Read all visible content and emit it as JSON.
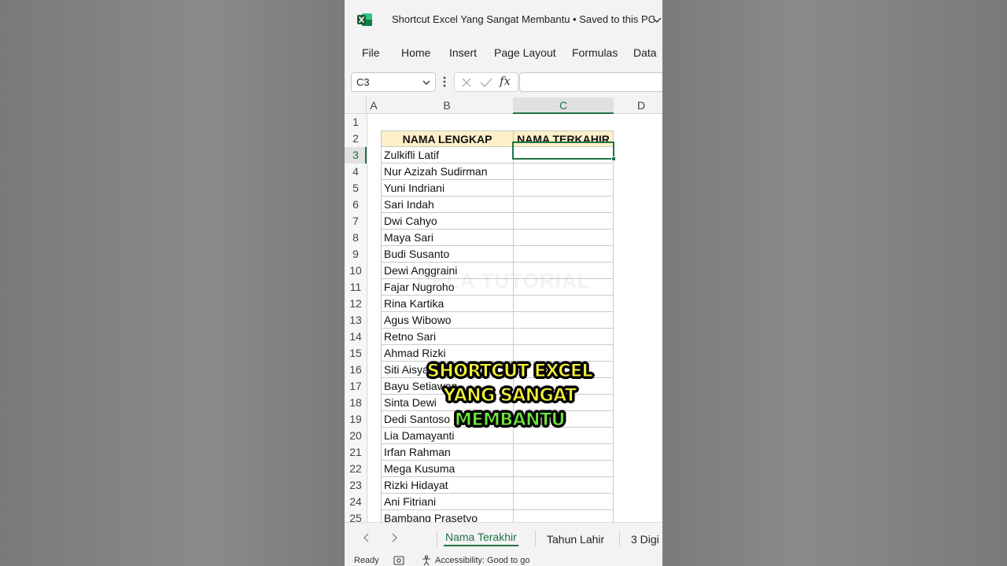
{
  "window": {
    "title": "Shortcut Excel Yang Sangat Membantu • Saved to this PC"
  },
  "ribbon": {
    "tabs": [
      "File",
      "Home",
      "Insert",
      "Page Layout",
      "Formulas",
      "Data"
    ]
  },
  "formula_bar": {
    "name_box": "C3",
    "formula": ""
  },
  "columns": [
    "A",
    "B",
    "C",
    "D"
  ],
  "selected_column": "C",
  "selected_row": 3,
  "rows": [
    "1",
    "2",
    "3",
    "4",
    "5",
    "6",
    "7",
    "8",
    "9",
    "10",
    "11",
    "12",
    "13",
    "14",
    "15",
    "16",
    "17",
    "18",
    "19",
    "20",
    "21",
    "22",
    "23",
    "24",
    "25"
  ],
  "table": {
    "headers": [
      "NAMA LENGKAP",
      "NAMA TERKAHIR"
    ],
    "names": [
      "Zulkifli Latif",
      "Nur Azizah Sudirman",
      "Yuni Indriani",
      "Sari Indah",
      "Dwi Cahyo",
      "Maya Sari",
      "Budi Susanto",
      "Dewi Anggraini",
      "Fajar Nugroho",
      "Rina Kartika",
      "Agus Wibowo",
      "Retno Sari",
      "Ahmad Rizki",
      "Siti Aisyah",
      "Bayu Setiawan",
      "Sinta Dewi",
      "Dedi Santoso",
      "Lia Damayanti",
      "Irfan Rahman",
      "Mega Kusuma",
      "Rizki Hidayat",
      "Ani Fitriani",
      "Bambang Prasetyo"
    ]
  },
  "overlay": {
    "line1": "SHORTCUT EXCEL",
    "line2": "YANG SANGAT",
    "line3": "MEMBANTU"
  },
  "watermark": "CELA TUTORIAL",
  "sheets": [
    "Nama Terakhir",
    "Tahun Lahir",
    "3 Digi"
  ],
  "active_sheet": "Nama Terakhir",
  "status": {
    "ready": "Ready",
    "accessibility": "Accessibility: Good to go"
  },
  "colors": {
    "accent": "#217346",
    "header_fill": "#fdf0c8"
  }
}
